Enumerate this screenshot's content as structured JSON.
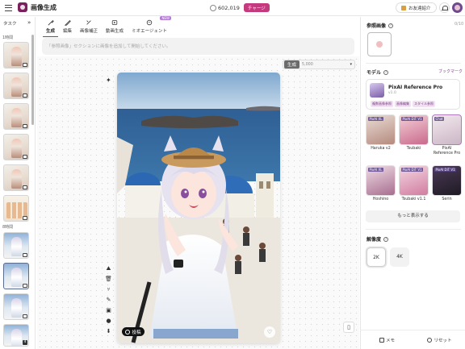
{
  "app": {
    "title": "画像生成"
  },
  "topbar": {
    "credits": "602,019",
    "charge_label": "チャージ",
    "friend_label": "お友達紹介"
  },
  "sidebar": {
    "tabs_label": "タスク",
    "expand_label": "»",
    "group_1h": "1時間",
    "group_8h": "8時間",
    "count_badge": "4"
  },
  "tool_tabs": [
    {
      "label": "生成"
    },
    {
      "label": "編集"
    },
    {
      "label": "画像補正"
    },
    {
      "label": "動画生成"
    },
    {
      "label": "ミオエージェント",
      "badge": "NEW"
    }
  ],
  "prompt": {
    "placeholder": "「参照画像」セクションに画像を追加して開始してください。"
  },
  "generate": {
    "label": "生成",
    "cost": "5,000"
  },
  "canvas": {
    "post_label": "投稿"
  },
  "right_panel": {
    "ref_title": "参照画像",
    "ref_count": "0/10",
    "model_title": "モデル",
    "bookmark_label": "ブックマーク",
    "selected_model": {
      "name": "PixAI Reference Pro",
      "version": "v1.0",
      "tags": [
        "複数画像参照",
        "画像編集",
        "スタイル参照"
      ]
    },
    "models": [
      {
        "name": "Haruka v2",
        "tag": "PixAI XL"
      },
      {
        "name": "Tsubaki",
        "tag": "PixAI DiT V1"
      },
      {
        "name": "PixAI Reference Pro",
        "tag": "Chat"
      },
      {
        "name": "Hoshino",
        "tag": "PixAI XL"
      },
      {
        "name": "Tsubaki v1.1",
        "tag": "PixAI DiT V1"
      },
      {
        "name": "Serin",
        "tag": "PixAI DiT V1"
      }
    ],
    "show_more_label": "もっと表示する",
    "resolution_title": "解像度",
    "resolutions": [
      "2K",
      "4K"
    ],
    "memo_label": "メモ",
    "reset_label": "リセット"
  },
  "colors": {
    "accent": "#8a3a8c",
    "charge": "#c43a7f",
    "tag_bg": "#f1e1f2"
  },
  "icons": {
    "menu": "hamburger-icon",
    "coin": "coin-icon",
    "gift": "gift-icon",
    "bell": "bell-icon",
    "trash": "trash-icon",
    "sparkle": "sparkle-icon",
    "globe": "globe-icon",
    "heart": "heart-icon"
  }
}
